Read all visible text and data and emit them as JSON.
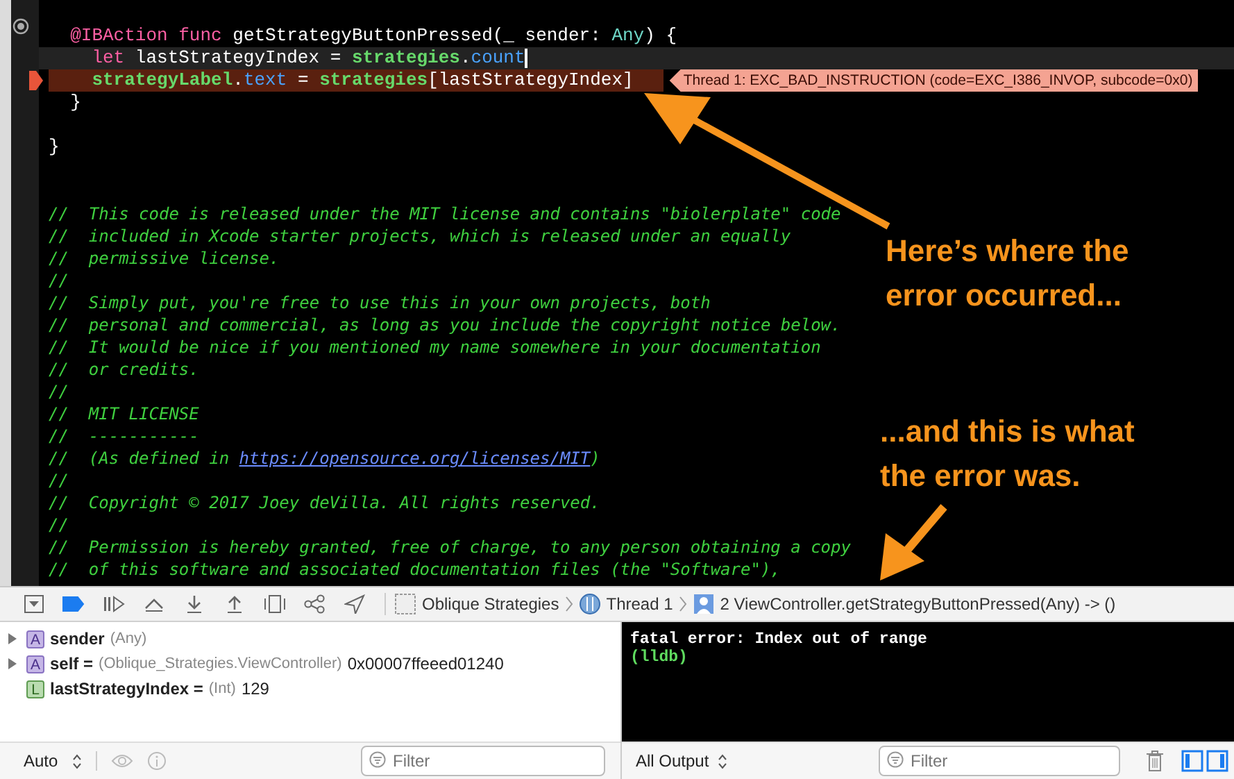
{
  "editor": {
    "lines": [
      {
        "current_line": false,
        "error": false,
        "tokens": [
          {
            "kind": "keyword",
            "text": "  @IBAction"
          },
          {
            "kind": "keyword",
            "text": " func"
          },
          {
            "kind": "plain",
            "text": " getStrategyButtonPressed(_ sender: "
          },
          {
            "kind": "type",
            "text": "Any"
          },
          {
            "kind": "plain",
            "text": ") {"
          }
        ]
      },
      {
        "current_line": true,
        "error": false,
        "tokens": [
          {
            "kind": "keyword",
            "text": "    let"
          },
          {
            "kind": "plain",
            "text": " lastStrategyIndex = "
          },
          {
            "kind": "project",
            "text": "strategies"
          },
          {
            "kind": "plain",
            "text": "."
          },
          {
            "kind": "property",
            "text": "count"
          }
        ]
      },
      {
        "current_line": false,
        "error": true,
        "annotation": "Thread 1: EXC_BAD_INSTRUCTION (code=EXC_I386_INVOP, subcode=0x0)",
        "tokens": [
          {
            "kind": "project",
            "text": "    strategyLabel"
          },
          {
            "kind": "plain",
            "text": "."
          },
          {
            "kind": "property",
            "text": "text"
          },
          {
            "kind": "plain",
            "text": " = "
          },
          {
            "kind": "project",
            "text": "strategies"
          },
          {
            "kind": "plain",
            "text": "[lastStrategyIndex]"
          }
        ]
      },
      {
        "current_line": false,
        "error": false,
        "tokens": [
          {
            "kind": "plain",
            "text": "  }"
          }
        ]
      },
      {
        "current_line": false,
        "error": false
      },
      {
        "current_line": false,
        "error": false,
        "tokens": [
          {
            "kind": "plain",
            "text": "}"
          }
        ]
      },
      {
        "current_line": false,
        "error": false
      },
      {
        "current_line": false,
        "error": false
      },
      {
        "current_line": false,
        "error": false,
        "tokens": [
          {
            "kind": "comment",
            "text": "//  This code is released under the MIT license and contains \"biolerplate\" code"
          }
        ]
      },
      {
        "current_line": false,
        "error": false,
        "tokens": [
          {
            "kind": "comment",
            "text": "//  included in Xcode starter projects, which is released under an equally"
          }
        ]
      },
      {
        "current_line": false,
        "error": false,
        "tokens": [
          {
            "kind": "comment",
            "text": "//  permissive license."
          }
        ]
      },
      {
        "current_line": false,
        "error": false,
        "tokens": [
          {
            "kind": "comment",
            "text": "//"
          }
        ]
      },
      {
        "current_line": false,
        "error": false,
        "tokens": [
          {
            "kind": "comment",
            "text": "//  Simply put, you're free to use this in your own projects, both"
          }
        ]
      },
      {
        "current_line": false,
        "error": false,
        "tokens": [
          {
            "kind": "comment",
            "text": "//  personal and commercial, as long as you include the copyright notice below."
          }
        ]
      },
      {
        "current_line": false,
        "error": false,
        "tokens": [
          {
            "kind": "comment",
            "text": "//  It would be nice if you mentioned my name somewhere in your documentation"
          }
        ]
      },
      {
        "current_line": false,
        "error": false,
        "tokens": [
          {
            "kind": "comment",
            "text": "//  or credits."
          }
        ]
      },
      {
        "current_line": false,
        "error": false,
        "tokens": [
          {
            "kind": "comment",
            "text": "//"
          }
        ]
      },
      {
        "current_line": false,
        "error": false,
        "tokens": [
          {
            "kind": "comment",
            "text": "//  MIT LICENSE"
          }
        ]
      },
      {
        "current_line": false,
        "error": false,
        "tokens": [
          {
            "kind": "comment",
            "text": "//  -----------"
          }
        ]
      },
      {
        "current_line": false,
        "error": false,
        "tokens": [
          {
            "kind": "comment",
            "text": "//  (As defined in "
          },
          {
            "kind": "link",
            "text": "https://opensource.org/licenses/MIT"
          },
          {
            "kind": "comment",
            "text": ")"
          }
        ]
      },
      {
        "current_line": false,
        "error": false,
        "tokens": [
          {
            "kind": "comment",
            "text": "//"
          }
        ]
      },
      {
        "current_line": false,
        "error": false,
        "tokens": [
          {
            "kind": "comment",
            "text": "//  Copyright © 2017 Joey deVilla. All rights reserved."
          }
        ]
      },
      {
        "current_line": false,
        "error": false,
        "tokens": [
          {
            "kind": "comment",
            "text": "//"
          }
        ]
      },
      {
        "current_line": false,
        "error": false,
        "tokens": [
          {
            "kind": "comment",
            "text": "//  Permission is hereby granted, free of charge, to any person obtaining a copy"
          }
        ]
      },
      {
        "current_line": false,
        "error": false,
        "tokens": [
          {
            "kind": "comment",
            "text": "//  of this software and associated documentation files (the \"Software\"),"
          }
        ]
      }
    ]
  },
  "callouts": [
    {
      "text": "Here’s where the error occurred..."
    },
    {
      "text": "...and this is what the error was."
    }
  ],
  "debug_bar": {
    "breakpoints_active": true,
    "jump_bar": [
      {
        "kind": "project",
        "text": "Oblique Strategies"
      },
      {
        "kind": "thread",
        "text": "Thread 1"
      },
      {
        "kind": "frame",
        "text": "2 ViewController.getStrategyButtonPressed(Any) -> ()"
      }
    ]
  },
  "variables": [
    {
      "kind": "argument",
      "badge": "A",
      "expandable": true,
      "name": "sender",
      "type": "(Any)"
    },
    {
      "kind": "argument",
      "badge": "A",
      "expandable": true,
      "name": "self =",
      "type": "(Oblique_Strategies.ViewController)",
      "value": "0x00007ffeeed01240"
    },
    {
      "kind": "local",
      "badge": "L",
      "expandable": false,
      "name": "lastStrategyIndex =",
      "type": "(Int)",
      "value": "129"
    }
  ],
  "console": [
    {
      "kind": "error",
      "text": "fatal error: Index out of range"
    },
    {
      "kind": "prompt",
      "text": "(lldb)"
    }
  ],
  "variables_footer": {
    "scope": "Auto",
    "filter_placeholder": "Filter"
  },
  "console_footer": {
    "output": "All Output",
    "filter_placeholder": "Filter"
  }
}
